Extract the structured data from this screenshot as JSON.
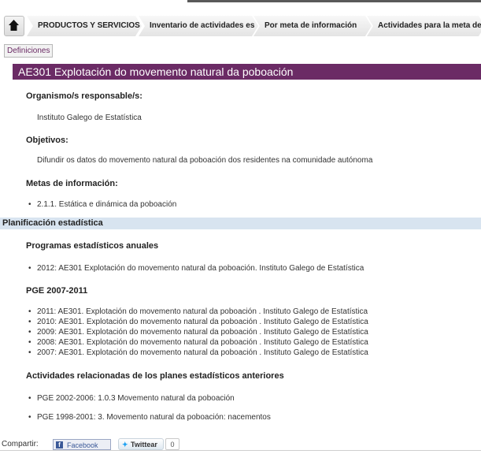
{
  "breadcrumb": {
    "home_icon": "home-icon",
    "items": [
      "PRODUCTOS Y SERVICIOS",
      "Inventario de actividades es",
      "Por meta de información",
      "Actividades para la meta de"
    ]
  },
  "definitions_label": "Definiciones",
  "title": "AE301 Explotación do movemento natural da poboación",
  "organismo": {
    "heading": "Organismo/s responsable/s:",
    "value": "Instituto Galego de Estatística"
  },
  "objetivos": {
    "heading": "Objetivos:",
    "value": "Difundir os datos do movemento natural da poboación dos residentes na comunidade autónoma"
  },
  "metas": {
    "heading": "Metas de información:",
    "items": [
      "2.1.1. Estática e dinámica da poboación"
    ]
  },
  "planificacion_label": "Planificación estadística",
  "programas": {
    "heading": "Programas estadísticos anuales",
    "items": [
      "2012: AE301 Explotación do movemento natural da poboación. Instituto Galego de Estatística"
    ]
  },
  "pge": {
    "heading": "PGE 2007-2011",
    "items": [
      "2011: AE301. Explotación do movemento natural da poboación . Instituto Galego de Estatística",
      "2010: AE301. Explotación do movemento natural da poboación . Instituto Galego de Estatística",
      "2009: AE301. Explotación do movemento natural da poboación . Instituto Galego de Estatística",
      "2008: AE301. Explotación do movemento natural da poboación . Instituto Galego de Estatística",
      "2007: AE301. Explotación do movemento natural da poboación . Instituto Galego de Estatística"
    ]
  },
  "actividades": {
    "heading": "Actividades relacionadas de los planes estadísticos anteriores",
    "items": [
      "PGE 2002-2006: 1.0.3 Movemento natural da poboación",
      "PGE 1998-2001: 3. Movemento natural da poboación: nacementos"
    ]
  },
  "share": {
    "label": "Compartir:",
    "facebook_label": "Facebook",
    "twitter_label": "Twittear",
    "twitter_count": "0"
  },
  "colors": {
    "title_bar": "#6b2b65",
    "section_bar": "#d8e4f0"
  }
}
